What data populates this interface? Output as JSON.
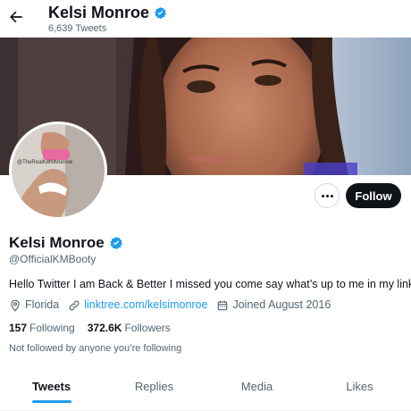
{
  "colors": {
    "accent": "#1d9bf0",
    "text_primary": "#0f1419",
    "text_secondary": "#536471",
    "follow_button_bg": "#0f1419"
  },
  "header": {
    "back_icon": "arrow-left-icon",
    "name": "Kelsi Monroe",
    "tweet_count": "6,639 Tweets",
    "verified_icon": "verified-badge-icon"
  },
  "banner": {
    "description_icon": "banner-photo"
  },
  "avatar": {
    "watermark": "@TheRealKelsiMonroe"
  },
  "actions": {
    "more_icon": "more-options-icon",
    "follow_label": "Follow"
  },
  "profile": {
    "name": "Kelsi Monroe",
    "handle": "@OfficialKMBooty",
    "bio": "Hello Twitter I am Back & Better  I missed you come say what’s up to me in my links",
    "location": "Florida",
    "location_icon": "location-pin-icon",
    "website": "linktree.com/kelsimonroe",
    "website_icon": "link-icon",
    "joined": "Joined August 2016",
    "joined_icon": "calendar-icon",
    "following_count": "157",
    "following_label": "Following",
    "followers_count": "372.6K",
    "followers_label": "Followers",
    "not_followed_text": "Not followed by anyone you’re following"
  },
  "tabs": [
    {
      "label": "Tweets",
      "active": true
    },
    {
      "label": "Replies",
      "active": false
    },
    {
      "label": "Media",
      "active": false
    },
    {
      "label": "Likes",
      "active": false
    }
  ]
}
